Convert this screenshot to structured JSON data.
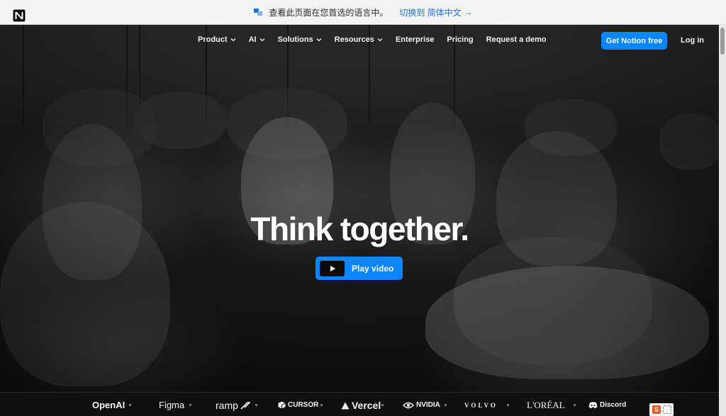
{
  "banner": {
    "message": "查看此页面在您首选的语言中。",
    "switch_label": "切换到 简体中文",
    "arrow": "→"
  },
  "nav": {
    "items": [
      {
        "label": "Product",
        "has_dropdown": true
      },
      {
        "label": "AI",
        "has_dropdown": true
      },
      {
        "label": "Solutions",
        "has_dropdown": true
      },
      {
        "label": "Resources",
        "has_dropdown": true
      },
      {
        "label": "Enterprise",
        "has_dropdown": false
      },
      {
        "label": "Pricing",
        "has_dropdown": false
      },
      {
        "label": "Request a demo",
        "has_dropdown": false
      }
    ],
    "cta_label": "Get Notion free",
    "login_label": "Log in"
  },
  "hero": {
    "headline": "Think together.",
    "play_label": "Play video"
  },
  "logos": [
    "OpenAI",
    "Figma",
    "ramp",
    "CURSOR",
    "Vercel",
    "NVIDIA",
    "VOLVO",
    "L'ORÉAL",
    "Discord"
  ],
  "colors": {
    "accent": "#0a85ff",
    "banner_bg": "#f3f3f1",
    "link": "#1d73d6"
  },
  "icons": [
    "translate-icon",
    "notion-logo-icon",
    "chevron-down-icon",
    "play-icon",
    "ramp-icon",
    "cursor-icon",
    "vercel-icon",
    "nvidia-icon",
    "discord-icon"
  ]
}
